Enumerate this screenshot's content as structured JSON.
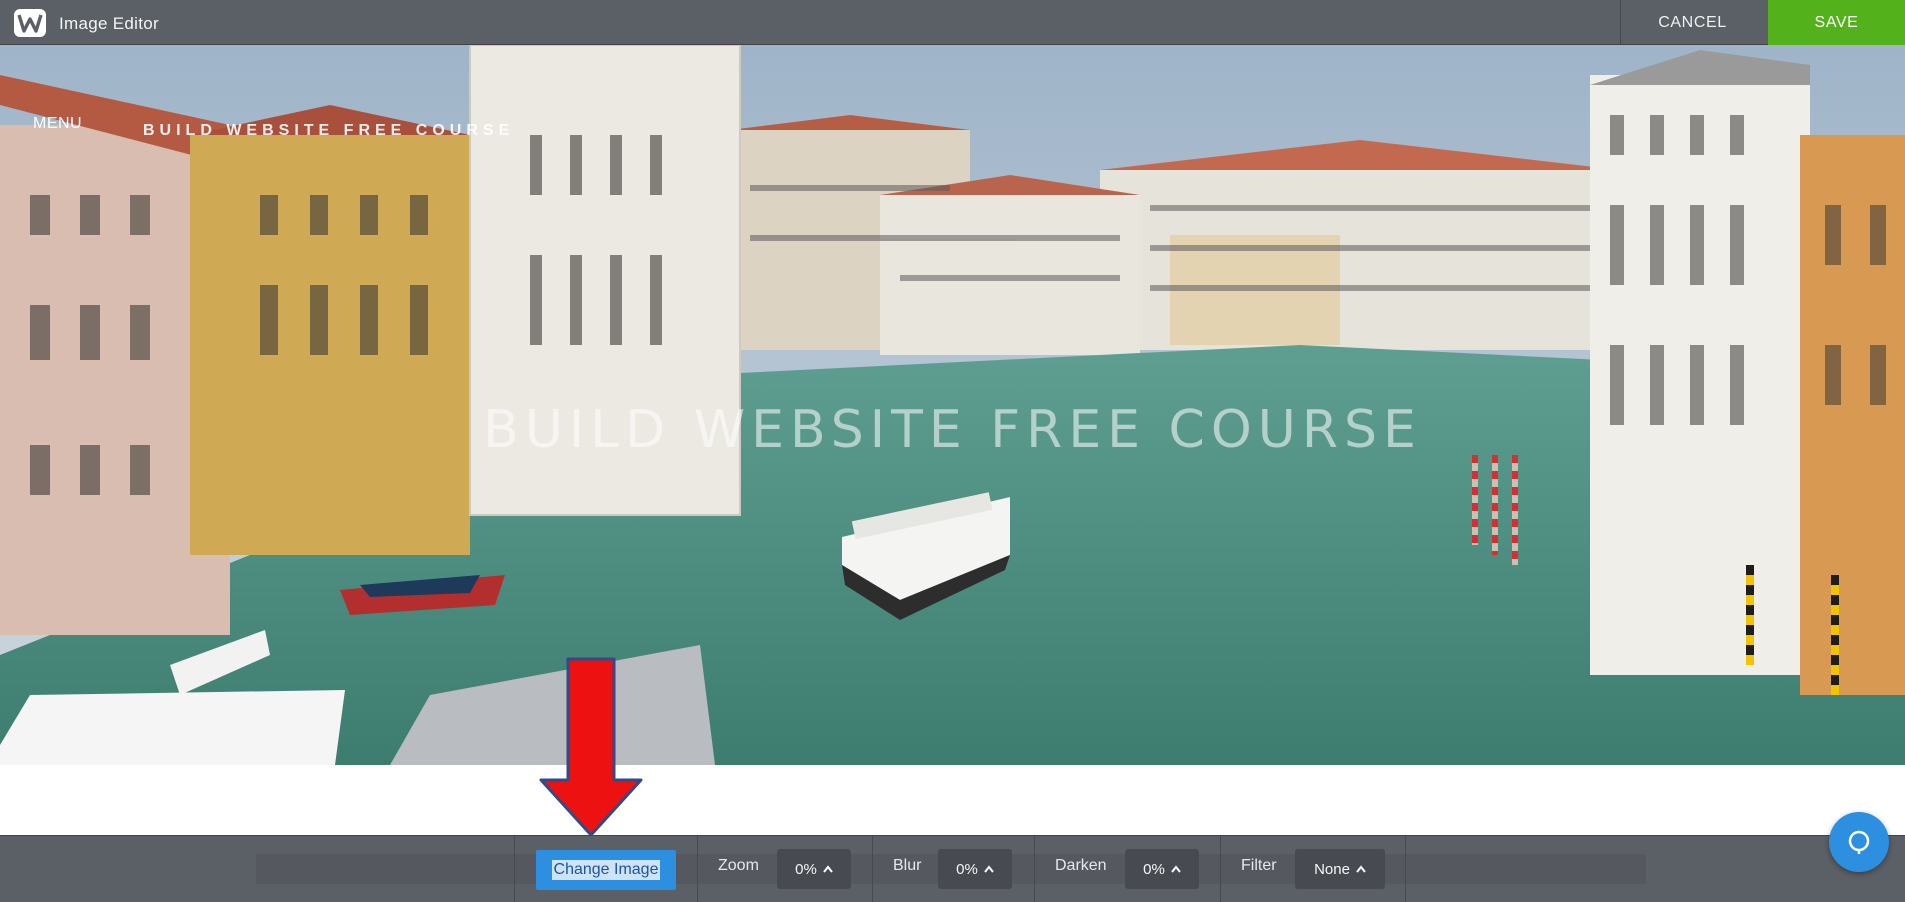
{
  "app": {
    "title": "Image Editor"
  },
  "header": {
    "cancel_label": "CANCEL",
    "save_label": "SAVE"
  },
  "canvas": {
    "menu_label": "MENU",
    "site_title_small": "BUILD WEBSITE FREE COURSE",
    "site_title_overlay": "BUILD WEBSITE FREE COURSE"
  },
  "toolbar": {
    "change_image_label": "Change Image",
    "zoom_label": "Zoom",
    "zoom_value": "0%",
    "blur_label": "Blur",
    "blur_value": "0%",
    "darken_label": "Darken",
    "darken_value": "0%",
    "filter_label": "Filter",
    "filter_value": "None"
  },
  "icons": {
    "logo": "weebly-w-logo",
    "caret": "chevron-up-icon",
    "help": "help-bubble-icon",
    "annotation": "red-down-arrow"
  },
  "colors": {
    "topbar": "#5b6066",
    "save": "#53b21c",
    "accent": "#2c8fe0",
    "arrow": "#ee1111"
  }
}
